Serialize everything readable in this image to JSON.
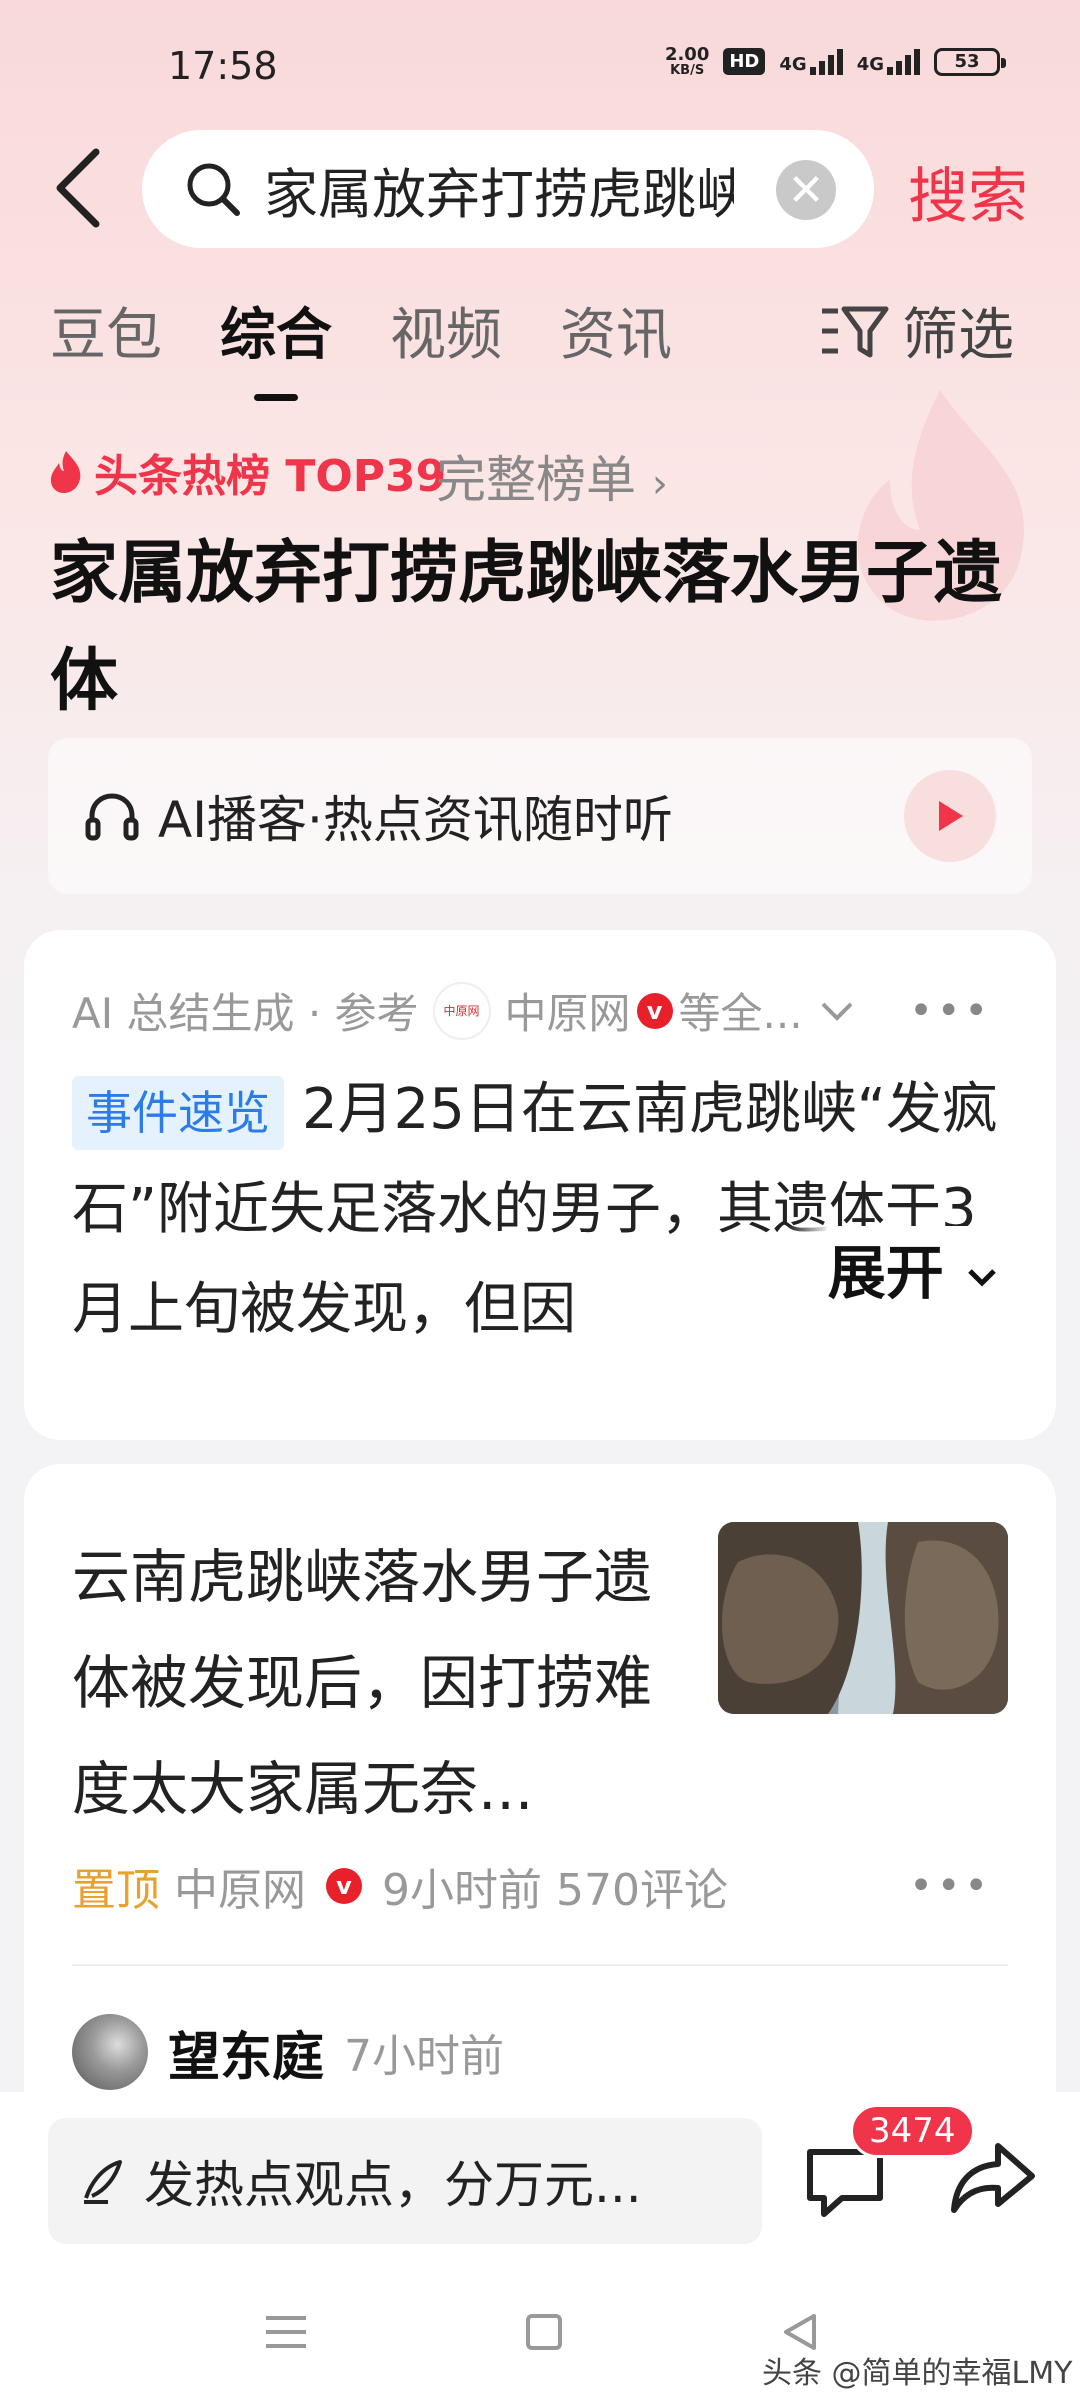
{
  "status": {
    "time": "17:58",
    "net_speed_value": "2.00",
    "net_speed_unit": "KB/S",
    "hd": "HD",
    "signal1": "4G",
    "signal2": "4G",
    "battery": "53"
  },
  "header": {
    "query": "家属放弃打捞虎跳峡落水男子遗体",
    "search_label": "搜索"
  },
  "tabs": [
    {
      "label": "豆包",
      "active": false
    },
    {
      "label": "综合",
      "active": true
    },
    {
      "label": "视频",
      "active": false
    },
    {
      "label": "资讯",
      "active": false
    }
  ],
  "filter_label": "筛选",
  "hot": {
    "label": "头条热榜 TOP39",
    "full_list": "完整榜单"
  },
  "headline": "家属放弃打捞虎跳峡落水男子遗体",
  "podcast": {
    "label": "AI播客·热点资讯随时听"
  },
  "ai_summary": {
    "prefix": "AI 总结生成 · 参考",
    "source": "中原网",
    "source_suffix": "等全...",
    "tag": "事件速览",
    "text": "2月25日在云南虎跳峡“发疯石”附近失足落水的男子，其遗体于3月上旬被发现，但因",
    "expand": "展开"
  },
  "news": {
    "title": "云南虎跳峡落水男子遗体被发现后，因打捞难度太大家属无奈...",
    "pin": "置顶",
    "source": "中原网",
    "time": "9小时前",
    "comments": "570评论",
    "author": {
      "name": "望东庭",
      "time": "7小时前"
    }
  },
  "bottom": {
    "compose_placeholder": "发热点观点，分万元...",
    "comment_count": "3474"
  },
  "watermark": "头条 @简单的幸福LMY",
  "colors": {
    "accent": "#f0354a",
    "pin": "#e7a22e",
    "tag_text": "#2a7ce8",
    "tag_bg": "#e5f1fd"
  }
}
